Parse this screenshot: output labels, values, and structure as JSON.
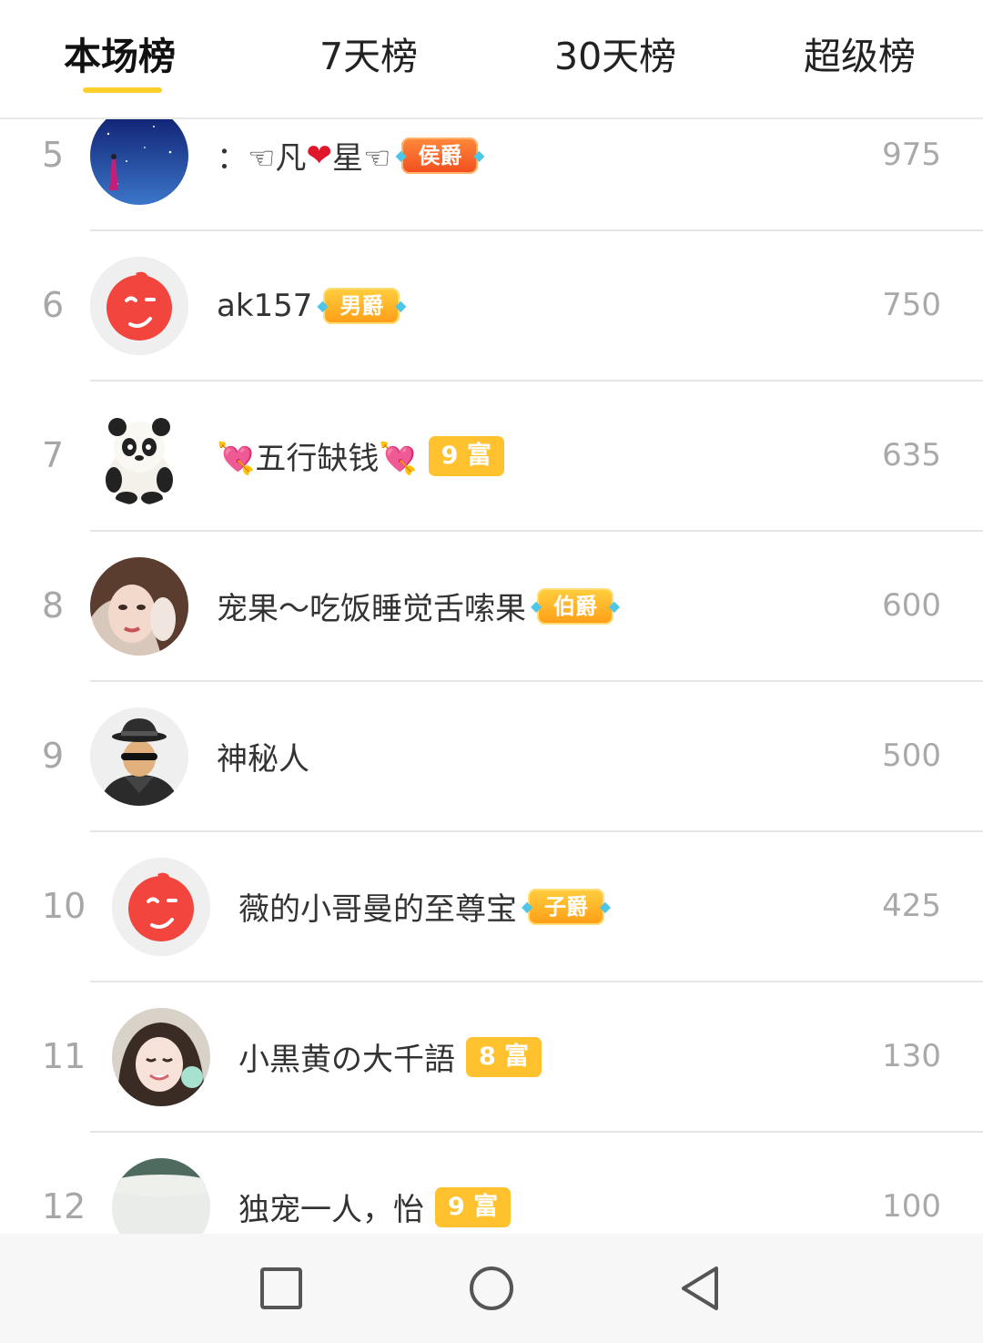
{
  "tabs": [
    {
      "label": "本场榜",
      "active": true
    },
    {
      "label": "7天榜",
      "active": false
    },
    {
      "label": "30天榜",
      "active": false
    },
    {
      "label": "超级榜",
      "active": false
    }
  ],
  "accent_color": "#ffcf2c",
  "rows": [
    {
      "rank": "5",
      "name_prefix": "：☜凡",
      "heart": "❤",
      "name_suffix": "星☜",
      "badge": "侯爵",
      "badge_type": "noble-red",
      "amount": "975",
      "avatar": "starry-night-avatar"
    },
    {
      "rank": "6",
      "name": "ak157",
      "badge": "男爵",
      "badge_type": "noble",
      "amount": "750",
      "avatar": "red-wink-face-avatar"
    },
    {
      "rank": "7",
      "name": "💘五行缺钱💘",
      "badge": "9 富",
      "badge_type": "rich",
      "amount": "635",
      "avatar": "panda-avatar"
    },
    {
      "rank": "8",
      "name": "宠果～吃饭睡觉舌嗦果",
      "badge": "伯爵",
      "badge_type": "noble",
      "amount": "600",
      "avatar": "girl-photo-avatar"
    },
    {
      "rank": "9",
      "name": "神秘人",
      "badge": "",
      "badge_type": "none",
      "amount": "500",
      "avatar": "mystery-man-avatar"
    },
    {
      "rank": "10",
      "name": "薇的小哥曼的至尊宝",
      "badge": "子爵",
      "badge_type": "noble",
      "amount": "425",
      "avatar": "red-wink-face-avatar"
    },
    {
      "rank": "11",
      "name": "小黒黄の大千語",
      "badge": "8 富",
      "badge_type": "rich",
      "amount": "130",
      "avatar": "smiling-girl-avatar"
    },
    {
      "rank": "12",
      "name": "独宠一人，怡",
      "badge": "9 富",
      "badge_type": "rich",
      "amount": "100",
      "avatar": "grey-photo-avatar"
    }
  ],
  "navbar": {
    "buttons": [
      "recent-apps",
      "home",
      "back"
    ]
  }
}
